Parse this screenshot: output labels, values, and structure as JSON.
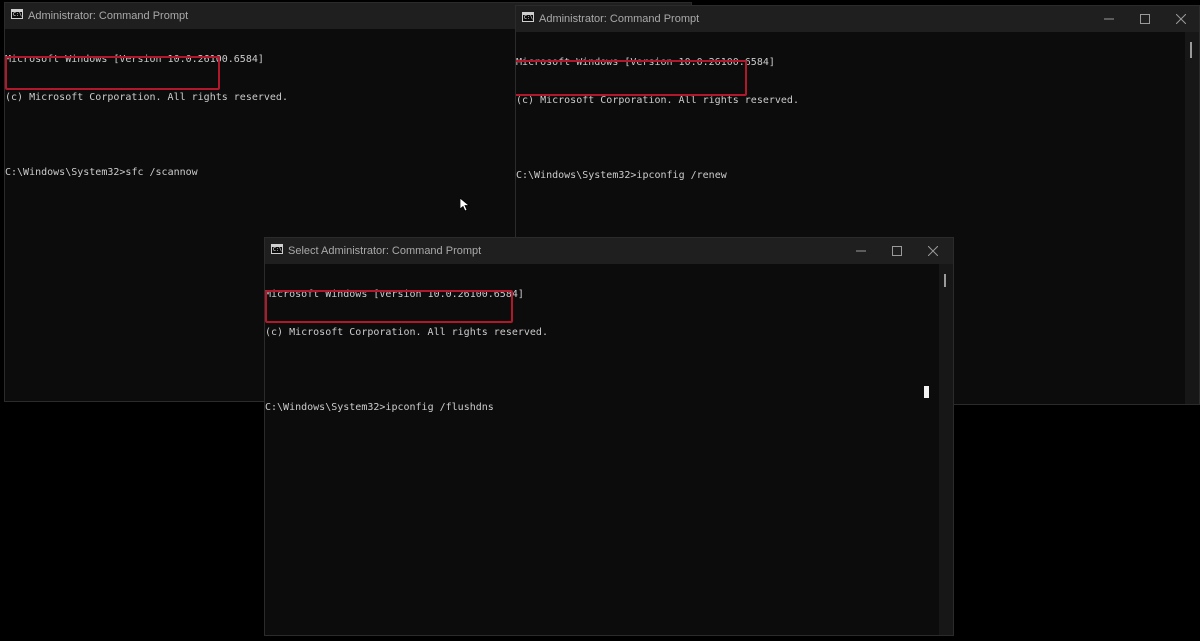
{
  "icons": {
    "app": "cmd-icon",
    "minimize": "minimize-icon",
    "maximize": "maximize-icon",
    "close": "close-icon",
    "pointer": "mouse-pointer-icon"
  },
  "colors": {
    "highlight": "#b2182b",
    "terminal_bg": "#0c0c0c",
    "titlebar_bg": "#1f1f1f",
    "text": "#cccccc"
  },
  "windows": {
    "left": {
      "title": "Administrator: Command Prompt",
      "icon_glyph": "C:\\",
      "lines": [
        "Microsoft Windows [Version 10.0.26100.6584]",
        "(c) Microsoft Corporation. All rights reserved."
      ],
      "prompt": "C:\\Windows\\System32>",
      "command": "sfc /scannow"
    },
    "right": {
      "title": "Administrator: Command Prompt",
      "icon_glyph": "C:\\",
      "lines": [
        "Microsoft Windows [Version 10.0.26100.6584]",
        "(c) Microsoft Corporation. All rights reserved."
      ],
      "prompt": "C:\\Windows\\System32>",
      "command": "ipconfig /renew"
    },
    "front": {
      "title": "Select Administrator: Command Prompt",
      "icon_glyph": "C:\\",
      "lines": [
        "Microsoft Windows [Version 10.0.26100.6584]",
        "(c) Microsoft Corporation. All rights reserved."
      ],
      "prompt": "C:\\Windows\\System32>",
      "command": "ipconfig /flushdns"
    }
  }
}
